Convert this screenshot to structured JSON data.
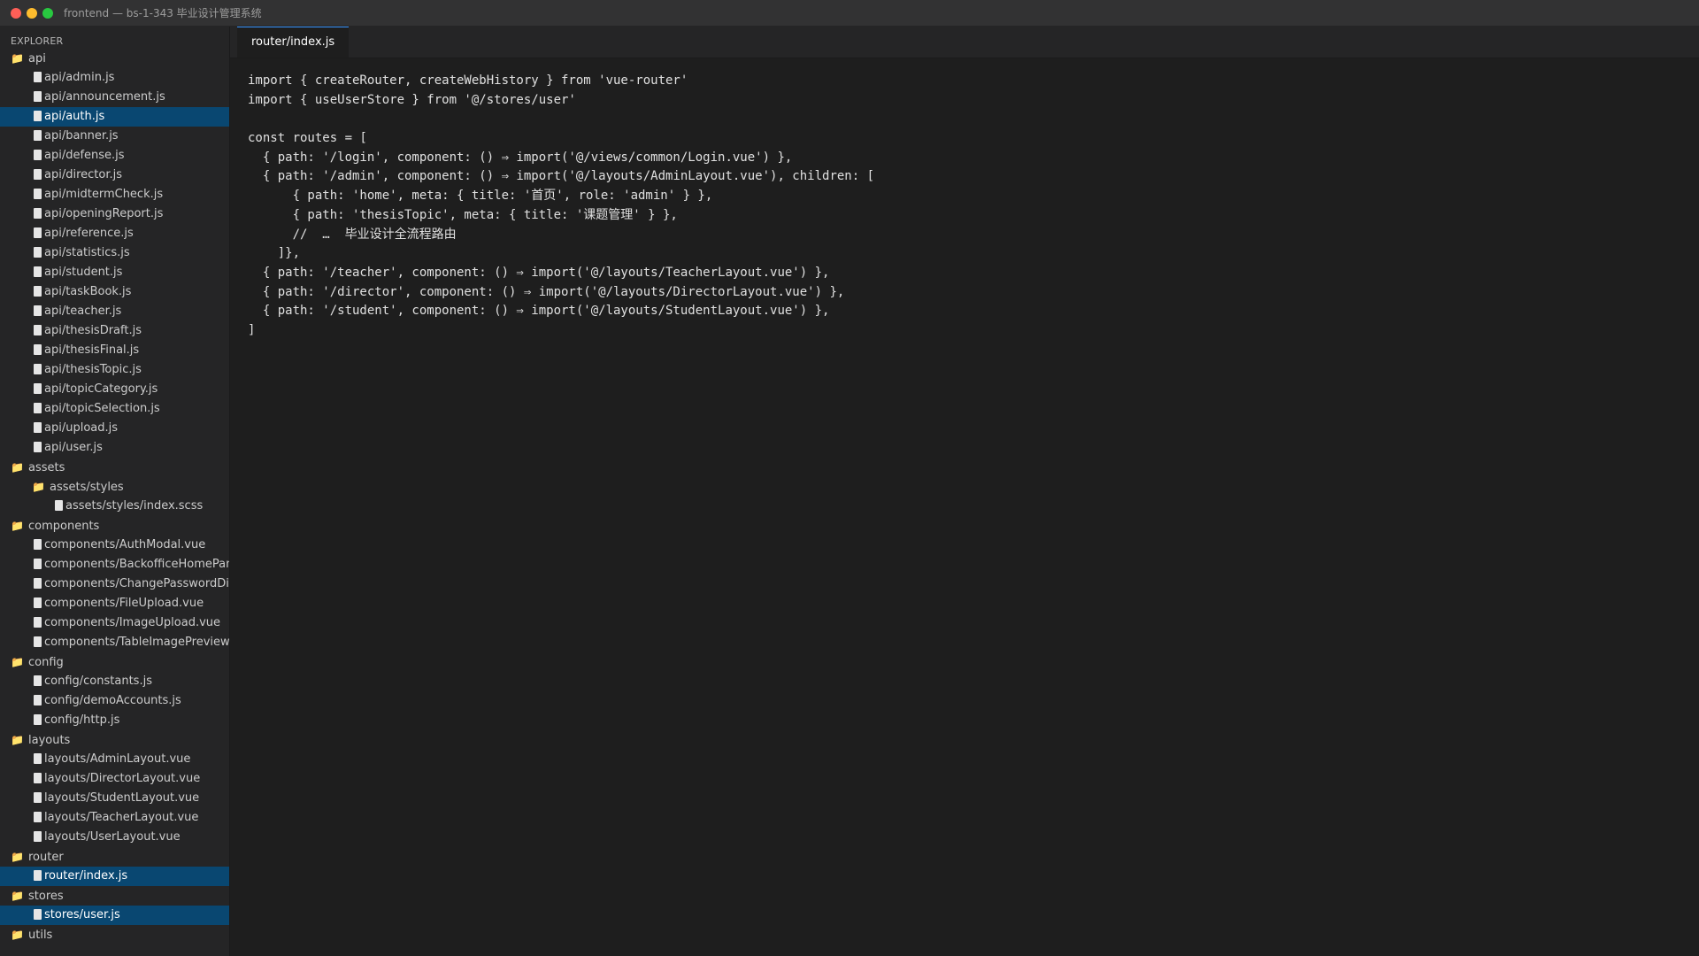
{
  "window": {
    "title": "frontend — bs-1-343 毕业设计管理系统",
    "traffic_lights": {
      "close": "#ff5f57",
      "minimize": "#febc2e",
      "maximize": "#28c840"
    }
  },
  "explorer": {
    "label": "EXPLORER",
    "items": [
      {
        "type": "folder",
        "label": "api",
        "depth": 0,
        "active": false
      },
      {
        "type": "file",
        "label": "api/admin.js",
        "depth": 1,
        "active": false
      },
      {
        "type": "file",
        "label": "api/announcement.js",
        "depth": 1,
        "active": false
      },
      {
        "type": "file",
        "label": "api/auth.js",
        "depth": 1,
        "active": true
      },
      {
        "type": "file",
        "label": "api/banner.js",
        "depth": 1,
        "active": false
      },
      {
        "type": "file",
        "label": "api/defense.js",
        "depth": 1,
        "active": false
      },
      {
        "type": "file",
        "label": "api/director.js",
        "depth": 1,
        "active": false
      },
      {
        "type": "file",
        "label": "api/midtermCheck.js",
        "depth": 1,
        "active": false
      },
      {
        "type": "file",
        "label": "api/openingReport.js",
        "depth": 1,
        "active": false
      },
      {
        "type": "file",
        "label": "api/reference.js",
        "depth": 1,
        "active": false
      },
      {
        "type": "file",
        "label": "api/statistics.js",
        "depth": 1,
        "active": false
      },
      {
        "type": "file",
        "label": "api/student.js",
        "depth": 1,
        "active": false
      },
      {
        "type": "file",
        "label": "api/taskBook.js",
        "depth": 1,
        "active": false
      },
      {
        "type": "file",
        "label": "api/teacher.js",
        "depth": 1,
        "active": false
      },
      {
        "type": "file",
        "label": "api/thesisDraft.js",
        "depth": 1,
        "active": false
      },
      {
        "type": "file",
        "label": "api/thesisFinal.js",
        "depth": 1,
        "active": false
      },
      {
        "type": "file",
        "label": "api/thesisTopic.js",
        "depth": 1,
        "active": false
      },
      {
        "type": "file",
        "label": "api/topicCategory.js",
        "depth": 1,
        "active": false
      },
      {
        "type": "file",
        "label": "api/topicSelection.js",
        "depth": 1,
        "active": false
      },
      {
        "type": "file",
        "label": "api/upload.js",
        "depth": 1,
        "active": false
      },
      {
        "type": "file",
        "label": "api/user.js",
        "depth": 1,
        "active": false
      },
      {
        "type": "folder",
        "label": "assets",
        "depth": 0,
        "active": false
      },
      {
        "type": "folder",
        "label": "assets/styles",
        "depth": 1,
        "active": false
      },
      {
        "type": "file",
        "label": "assets/styles/index.scss",
        "depth": 2,
        "active": false
      },
      {
        "type": "folder",
        "label": "components",
        "depth": 0,
        "active": false
      },
      {
        "type": "file",
        "label": "components/AuthModal.vue",
        "depth": 1,
        "active": false
      },
      {
        "type": "file",
        "label": "components/BackofficeHomePanel.vue",
        "depth": 1,
        "active": false
      },
      {
        "type": "file",
        "label": "components/ChangePasswordDialog.vue",
        "depth": 1,
        "active": false
      },
      {
        "type": "file",
        "label": "components/FileUpload.vue",
        "depth": 1,
        "active": false
      },
      {
        "type": "file",
        "label": "components/ImageUpload.vue",
        "depth": 1,
        "active": false
      },
      {
        "type": "file",
        "label": "components/TableImagePreview.vue",
        "depth": 1,
        "active": false
      },
      {
        "type": "folder",
        "label": "config",
        "depth": 0,
        "active": false
      },
      {
        "type": "file",
        "label": "config/constants.js",
        "depth": 1,
        "active": false
      },
      {
        "type": "file",
        "label": "config/demoAccounts.js",
        "depth": 1,
        "active": false
      },
      {
        "type": "file",
        "label": "config/http.js",
        "depth": 1,
        "active": false
      },
      {
        "type": "folder",
        "label": "layouts",
        "depth": 0,
        "active": false
      },
      {
        "type": "file",
        "label": "layouts/AdminLayout.vue",
        "depth": 1,
        "active": false
      },
      {
        "type": "file",
        "label": "layouts/DirectorLayout.vue",
        "depth": 1,
        "active": false
      },
      {
        "type": "file",
        "label": "layouts/StudentLayout.vue",
        "depth": 1,
        "active": false
      },
      {
        "type": "file",
        "label": "layouts/TeacherLayout.vue",
        "depth": 1,
        "active": false
      },
      {
        "type": "file",
        "label": "layouts/UserLayout.vue",
        "depth": 1,
        "active": false
      },
      {
        "type": "folder",
        "label": "router",
        "depth": 0,
        "active": false
      },
      {
        "type": "file",
        "label": "router/index.js",
        "depth": 1,
        "active": true
      },
      {
        "type": "folder",
        "label": "stores",
        "depth": 0,
        "active": false
      },
      {
        "type": "file",
        "label": "stores/user.js",
        "depth": 1,
        "active": true
      },
      {
        "type": "folder",
        "label": "utils",
        "depth": 0,
        "active": false
      }
    ]
  },
  "tabs": [
    {
      "label": "router/index.js",
      "active": true
    }
  ],
  "editor": {
    "lines": [
      "import { createRouter, createWebHistory } from 'vue-router'",
      "import { useUserStore } from '@/stores/user'",
      "",
      "const routes = [",
      "  { path: '/login', component: () ⇒ import('@/views/common/Login.vue') },",
      "  { path: '/admin', component: () ⇒ import('@/layouts/AdminLayout.vue'), children: [",
      "      { path: 'home', meta: { title: '首页', role: 'admin' } },",
      "      { path: 'thesisTopic', meta: { title: '课题管理' } },",
      "      //  …  毕业设计全流程路由",
      "    ]},",
      "  { path: '/teacher', component: () ⇒ import('@/layouts/TeacherLayout.vue') },",
      "  { path: '/director', component: () ⇒ import('@/layouts/DirectorLayout.vue') },",
      "  { path: '/student', component: () ⇒ import('@/layouts/StudentLayout.vue') },",
      "]"
    ]
  }
}
